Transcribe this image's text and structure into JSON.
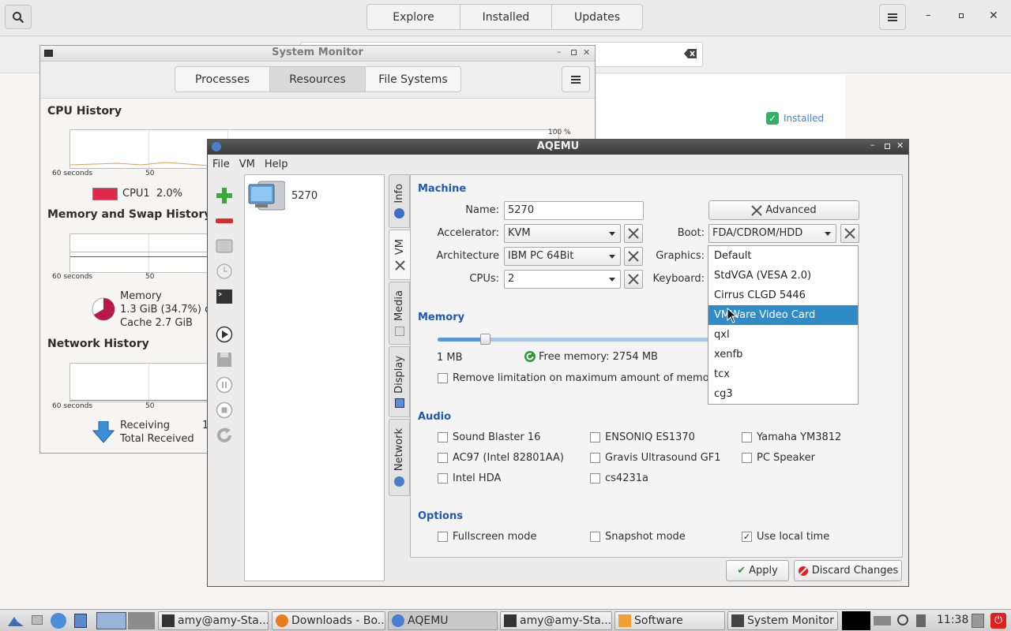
{
  "software": {
    "tabs": [
      "Explore",
      "Installed",
      "Updates"
    ],
    "installed_label": "Installed"
  },
  "sysmon": {
    "title": "System Monitor",
    "tabs": [
      "Processes",
      "Resources",
      "File Systems"
    ],
    "active_tab": "Resources",
    "cpu": {
      "heading": "CPU History",
      "pct_label": "100 %",
      "x_left": "60 seconds",
      "x_mid": "50",
      "legend": "CPU1  2.0%",
      "color": "#e0284a"
    },
    "memory": {
      "heading": "Memory and Swap History",
      "x_left": "60 seconds",
      "x_mid": "50",
      "label": "Memory",
      "value": "1.3 GiB (34.7%) o",
      "cache": "Cache 2.7 GiB"
    },
    "network": {
      "heading": "Network History",
      "x_left": "60 seconds",
      "x_mid": "50",
      "receiving": "Receiving",
      "total_received": "Total Received",
      "partial": "1"
    }
  },
  "aqemu": {
    "title": "AQEMU",
    "menu": [
      "File",
      "VM",
      "Help"
    ],
    "vm_list": [
      {
        "name": "5270"
      }
    ],
    "tabs": [
      "Info",
      "VM",
      "Media",
      "Display",
      "Network"
    ],
    "active_tab": "VM",
    "machine": {
      "heading": "Machine",
      "name_label": "Name:",
      "name_value": "5270",
      "advanced_label": "Advanced",
      "accel_label": "Accelerator:",
      "accel_value": "KVM",
      "boot_label": "Boot:",
      "boot_value": "FDA/CDROM/HDD",
      "arch_label": "Architecture",
      "arch_value": "IBM PC 64Bit",
      "graphics_label": "Graphics:",
      "cpus_label": "CPUs:",
      "cpus_value": "2",
      "keyboard_label": "Keyboard:"
    },
    "memory": {
      "heading": "Memory",
      "min_label": "1 MB",
      "free_label": "Free memory: 2754 MB",
      "remove_limit_label": "Remove limitation on maximum amount of memo"
    },
    "audio": {
      "heading": "Audio",
      "items": [
        "Sound Blaster 16",
        "ENSONIQ ES1370",
        "Yamaha YM3812",
        "AC97 (Intel 82801AA)",
        "Gravis Ultrasound GF1",
        "PC Speaker",
        "Intel HDA",
        "cs4231a"
      ]
    },
    "options": {
      "heading": "Options",
      "fullscreen": "Fullscreen mode",
      "snapshot": "Snapshot mode",
      "localtime": "Use local time",
      "localtime_checked": true
    },
    "apply_label": "Apply",
    "discard_label": "Discard Changes",
    "graphics_options": [
      "Default",
      "StdVGA (VESA 2.0)",
      "Cirrus CLGD 5446",
      "VMWare Video Card",
      "qxl",
      "xenfb",
      "tcx",
      "cg3"
    ],
    "graphics_highlighted": "VMWare Video Card"
  },
  "taskbar": {
    "tasks": [
      "amy@amy-Sta...",
      "Downloads - Bo...",
      "AQEMU",
      "amy@amy-Sta...",
      "Software",
      "System Monitor"
    ],
    "clock": "11:38"
  }
}
